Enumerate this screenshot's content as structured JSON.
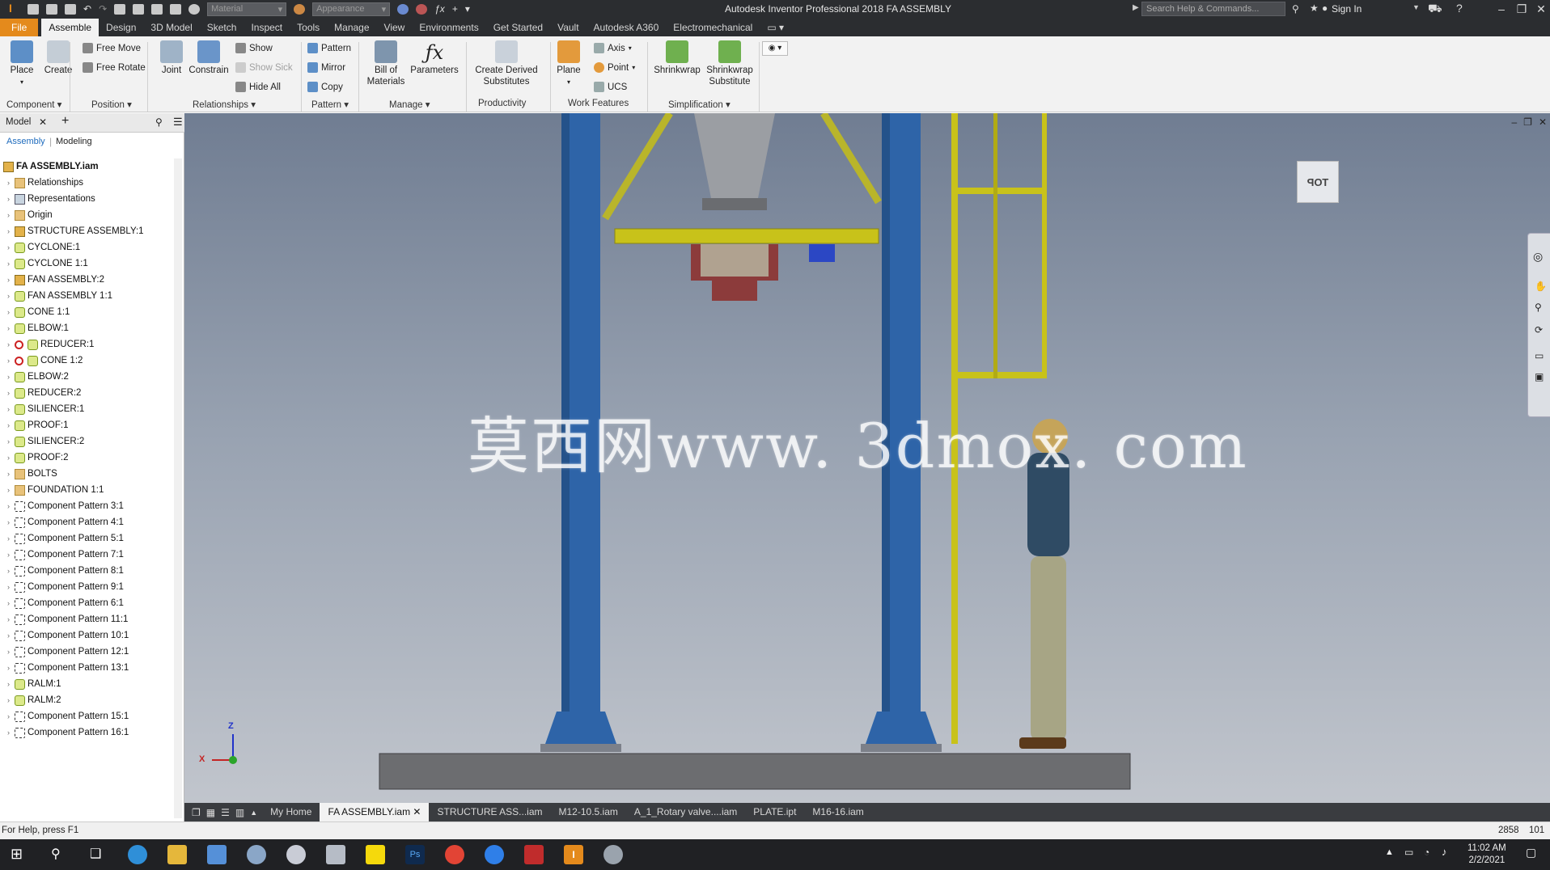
{
  "titlebar": {
    "app_title": "Autodesk Inventor Professional 2018   FA ASSEMBLY",
    "material_select": "Material",
    "appearance_select": "Appearance",
    "search_placeholder": "Search Help & Commands...",
    "sign_in": "Sign In"
  },
  "menu_tabs": [
    "File",
    "Assemble",
    "Design",
    "3D Model",
    "Sketch",
    "Inspect",
    "Tools",
    "Manage",
    "View",
    "Environments",
    "Get Started",
    "Vault",
    "Autodesk A360",
    "Electromechanical"
  ],
  "ribbon": {
    "place": "Place",
    "create": "Create",
    "free_move": "Free Move",
    "free_rotate": "Free Rotate",
    "joint": "Joint",
    "constrain": "Constrain",
    "show": "Show",
    "show_sick": "Show Sick",
    "hide_all": "Hide All",
    "pattern": "Pattern",
    "mirror": "Mirror",
    "copy": "Copy",
    "bill_of_materials_1": "Bill of",
    "bill_of_materials_2": "Materials",
    "parameters": "Parameters",
    "create_derived_1": "Create Derived",
    "create_derived_2": "Substitutes",
    "plane": "Plane",
    "axis": "Axis",
    "point": "Point",
    "ucs": "UCS",
    "shrinkwrap": "Shrinkwrap",
    "shrinkwrap_sub_1": "Shrinkwrap",
    "shrinkwrap_sub_2": "Substitute",
    "panels": {
      "component": "Component ▾",
      "position": "Position ▾",
      "relationships": "Relationships ▾",
      "pattern": "Pattern ▾",
      "manage": "Manage ▾",
      "productivity": "Productivity",
      "work_features": "Work Features",
      "simplification": "Simplification ▾"
    }
  },
  "browser": {
    "tab_label": "Model",
    "subtab_assembly": "Assembly",
    "subtab_modeling": "Modeling",
    "root": "FA ASSEMBLY.iam",
    "items": [
      {
        "label": "Relationships",
        "icon": "folder"
      },
      {
        "label": "Representations",
        "icon": "rel"
      },
      {
        "label": "Origin",
        "icon": "folder"
      },
      {
        "label": "STRUCTURE ASSEMBLY:1",
        "icon": "asm"
      },
      {
        "label": "CYCLONE:1",
        "icon": "part"
      },
      {
        "label": "CYCLONE 1:1",
        "icon": "part"
      },
      {
        "label": "FAN ASSEMBLY:2",
        "icon": "asm"
      },
      {
        "label": "FAN ASSEMBLY 1:1",
        "icon": "part"
      },
      {
        "label": "CONE 1:1",
        "icon": "part"
      },
      {
        "label": "ELBOW:1",
        "icon": "part"
      },
      {
        "label": "REDUCER:1",
        "icon": "part",
        "redx": true
      },
      {
        "label": "CONE 1:2",
        "icon": "part",
        "redx": true
      },
      {
        "label": "ELBOW:2",
        "icon": "part"
      },
      {
        "label": "REDUCER:2",
        "icon": "part"
      },
      {
        "label": "SILIENCER:1",
        "icon": "part"
      },
      {
        "label": "PROOF:1",
        "icon": "part"
      },
      {
        "label": "SILIENCER:2",
        "icon": "part"
      },
      {
        "label": "PROOF:2",
        "icon": "part"
      },
      {
        "label": "BOLTS",
        "icon": "folder"
      },
      {
        "label": "FOUNDATION 1:1",
        "icon": "folder"
      },
      {
        "label": "Component Pattern 3:1",
        "icon": "pattern"
      },
      {
        "label": "Component Pattern 4:1",
        "icon": "pattern"
      },
      {
        "label": "Component Pattern 5:1",
        "icon": "pattern"
      },
      {
        "label": "Component Pattern 7:1",
        "icon": "pattern"
      },
      {
        "label": "Component Pattern 8:1",
        "icon": "pattern"
      },
      {
        "label": "Component Pattern 9:1",
        "icon": "pattern"
      },
      {
        "label": "Component Pattern 6:1",
        "icon": "pattern"
      },
      {
        "label": "Component Pattern 11:1",
        "icon": "pattern"
      },
      {
        "label": "Component Pattern 10:1",
        "icon": "pattern"
      },
      {
        "label": "Component Pattern 12:1",
        "icon": "pattern"
      },
      {
        "label": "Component Pattern 13:1",
        "icon": "pattern"
      },
      {
        "label": "RALM:1",
        "icon": "part"
      },
      {
        "label": "RALM:2",
        "icon": "part"
      },
      {
        "label": "Component Pattern 15:1",
        "icon": "pattern"
      },
      {
        "label": "Component Pattern 16:1",
        "icon": "pattern"
      }
    ]
  },
  "viewport": {
    "viewcube_face": "TOP",
    "watermark": "莫西网www. 3dmox. com",
    "triad_z": "Z",
    "triad_x": "X"
  },
  "doc_tabs": [
    "My Home",
    "FA ASSEMBLY.iam",
    "STRUCTURE ASS...iam",
    "M12-10.5.iam",
    "A_1_Rotary valve....iam",
    "PLATE.ipt",
    "M16-16.iam"
  ],
  "active_doc_tab": "FA ASSEMBLY.iam",
  "status": {
    "help": "For Help, press F1",
    "count1": "2858",
    "count2": "101"
  },
  "taskbar": {
    "time": "11:02 AM",
    "date": "2/2/2021"
  },
  "colors": {
    "file_tab": "#e48a1c",
    "steel_blue": "#2e64a8",
    "ladder_yellow": "#c8c21a",
    "truss_yellow": "#b9b52a"
  }
}
